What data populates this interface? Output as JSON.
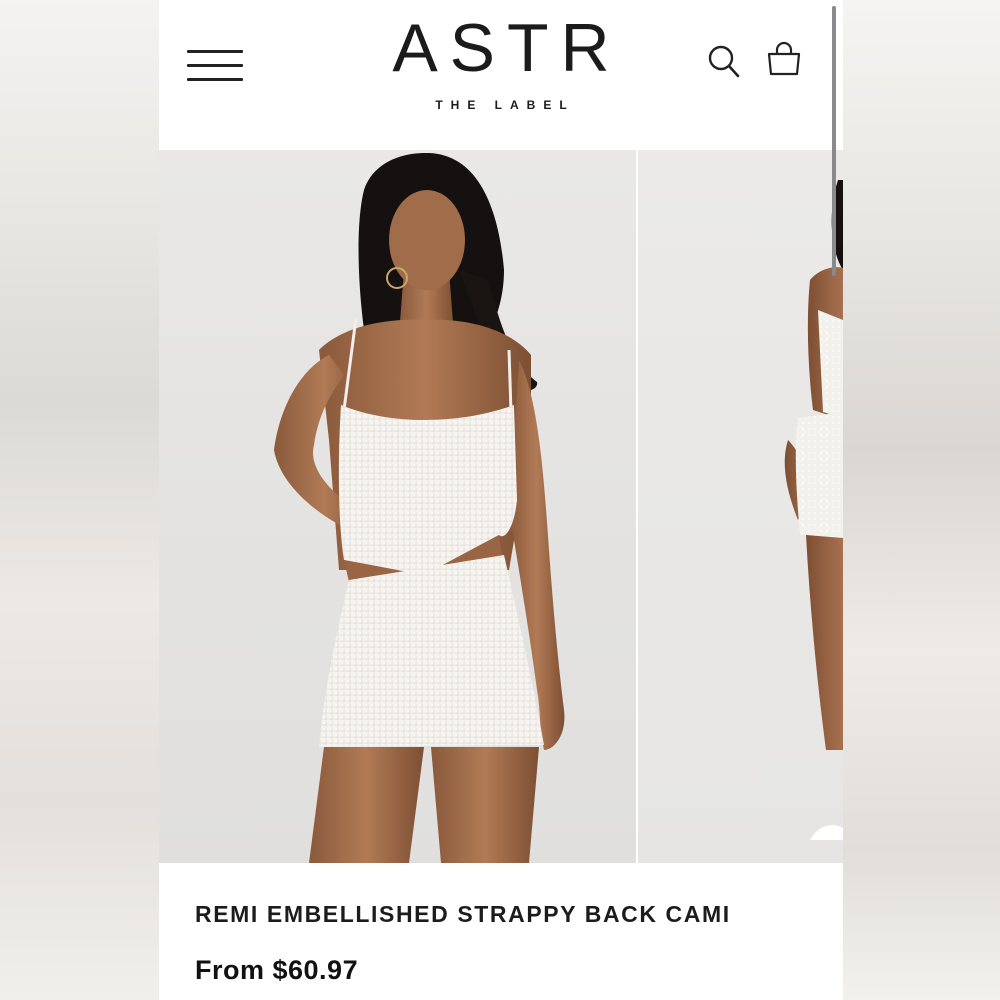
{
  "header": {
    "brand": "ASTR",
    "brand_tagline": "THE LABEL"
  },
  "icons": {
    "menu": "hamburger-menu-icon",
    "search": "search-icon",
    "bag": "shopping-bag-icon"
  },
  "product": {
    "title": "REMI EMBELLISHED STRAPPY BACK CAMI",
    "price": "From $60.97"
  },
  "colors": {
    "text": "#1c1c1c",
    "background": "#ffffff",
    "garment": "#f4f2ee"
  }
}
